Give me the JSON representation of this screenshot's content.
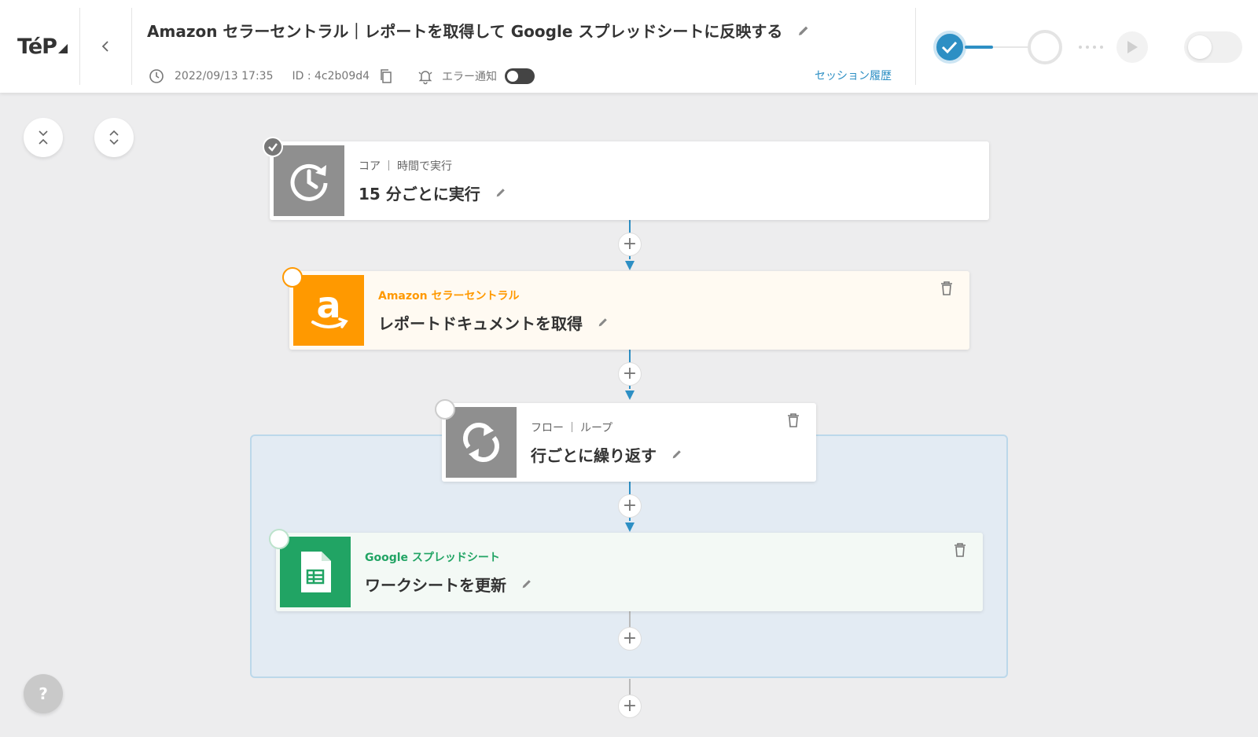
{
  "header": {
    "logo": "TéP",
    "title": "Amazon セラーセントラル｜レポートを取得して Google スプレッドシートに反映する",
    "timestamp": "2022/09/13 17:35",
    "id_label": "ID : 4c2b09d4",
    "error_notify_label": "エラー通知",
    "error_notify_on": false,
    "session_history_link": "セッション履歴",
    "publish_toggle_on": false
  },
  "flow": {
    "steps": [
      {
        "category": "コア",
        "subcategory": "時間で実行",
        "name": "15 分ごとに実行",
        "icon": "clock-refresh-icon",
        "status": "completed"
      },
      {
        "category": "Amazon セラーセントラル",
        "name": "レポートドキュメントを取得",
        "icon": "amazon-icon",
        "status": "pending",
        "color": "#ff9900"
      },
      {
        "category": "フロー",
        "subcategory": "ループ",
        "name": "行ごとに繰り返す",
        "icon": "loop-icon",
        "status": "pending"
      },
      {
        "category": "Google スプレッドシート",
        "name": "ワークシートを更新",
        "icon": "google-sheets-icon",
        "status": "pending",
        "color": "#21a464"
      }
    ],
    "add_step_label": "+"
  },
  "help_label": "?",
  "colors": {
    "accent": "#2d8fc4",
    "amazon": "#ff9900",
    "amazon_card_bg": "#fffaf2",
    "sheets": "#21a464",
    "sheets_card_bg": "#f3f9f5",
    "core_icon_bg": "#8f8f8f",
    "loop_bg": "#e3ebf3"
  }
}
